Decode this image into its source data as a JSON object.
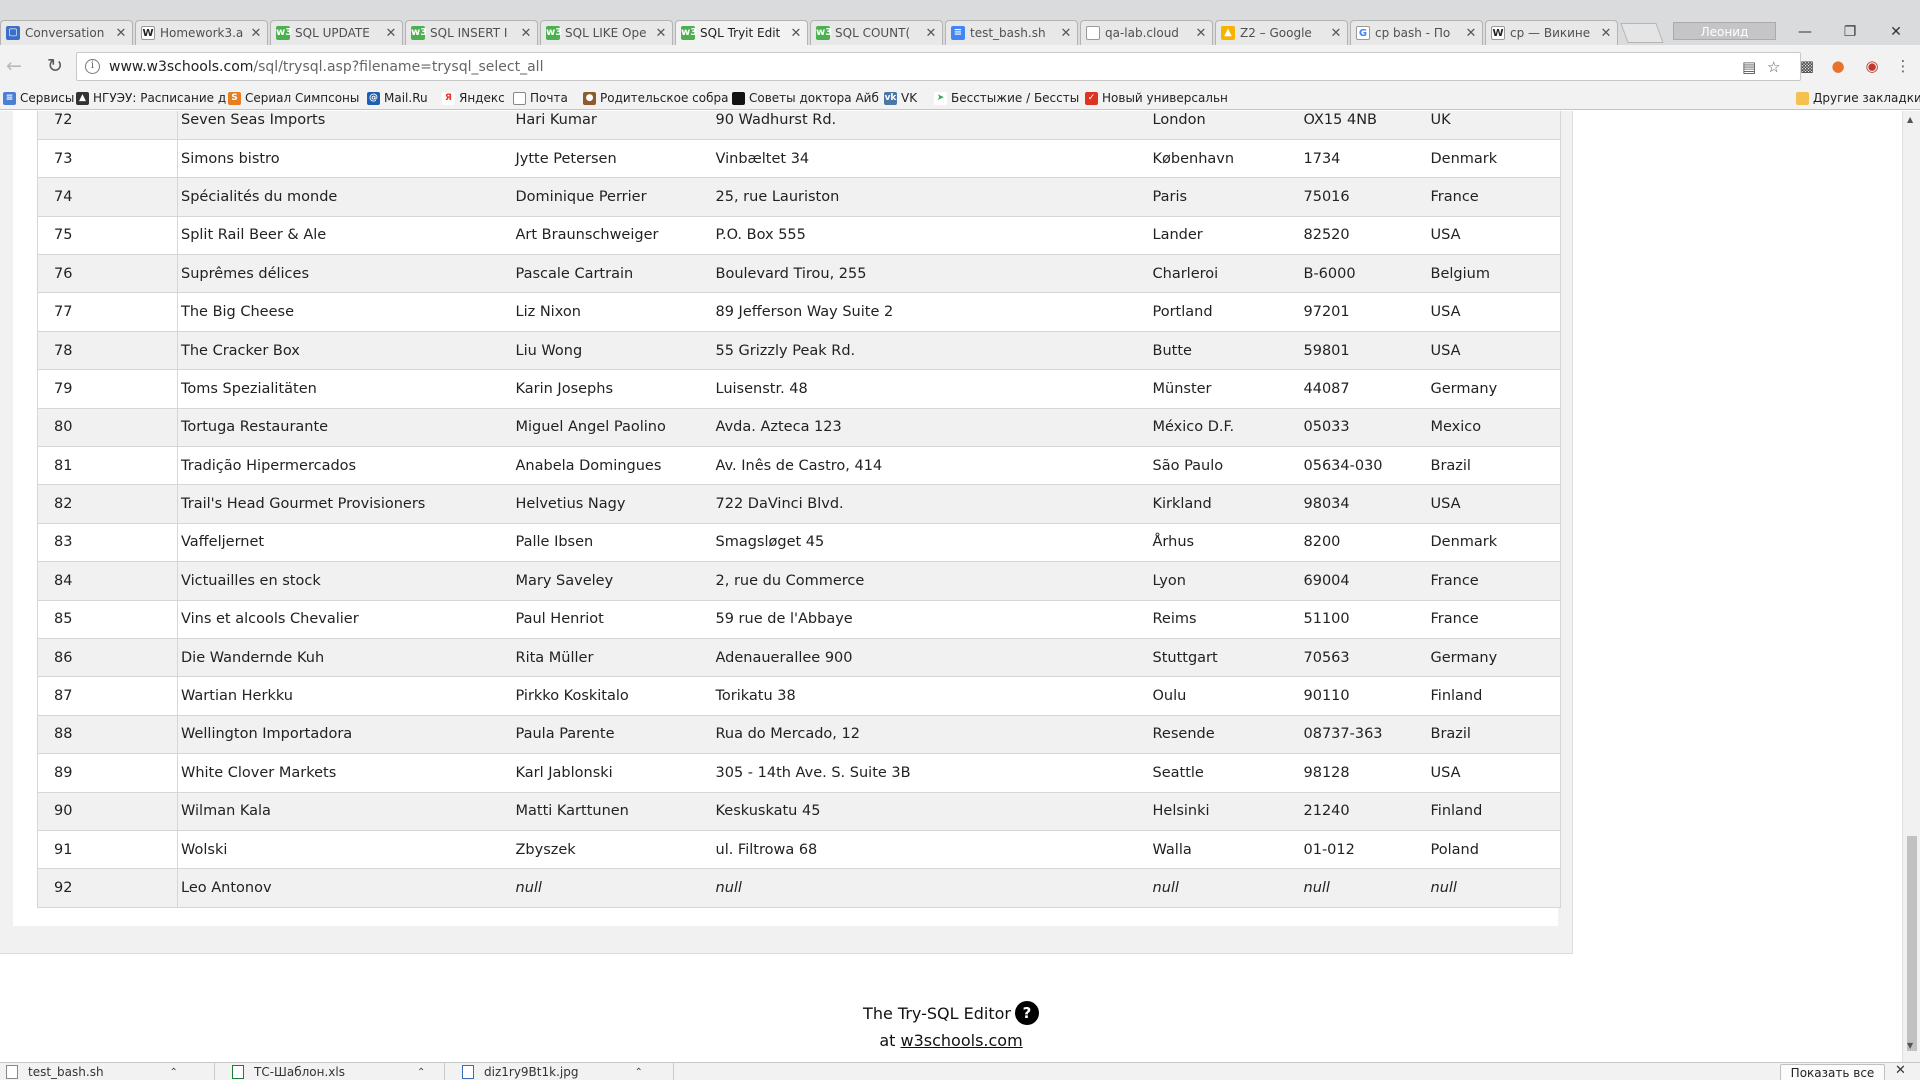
{
  "browser": {
    "tabs": [
      {
        "title": "Conversation",
        "icon": "chat-icon"
      },
      {
        "title": "Homework3.a",
        "icon": "word-icon"
      },
      {
        "title": "SQL UPDATE",
        "icon": "w3-icon"
      },
      {
        "title": "SQL INSERT I",
        "icon": "w3-icon"
      },
      {
        "title": "SQL LIKE Ope",
        "icon": "w3-icon"
      },
      {
        "title": "SQL Tryit Edit",
        "icon": "w3-icon",
        "active": true
      },
      {
        "title": "SQL COUNT(",
        "icon": "w3-icon"
      },
      {
        "title": "test_bash.sh",
        "icon": "doc-icon"
      },
      {
        "title": "qa-lab.cloud",
        "icon": "page-icon"
      },
      {
        "title": "Z2 – Google",
        "icon": "drive-icon"
      },
      {
        "title": "cp bash - По",
        "icon": "google-icon"
      },
      {
        "title": "cp — Викине",
        "icon": "wiki-icon"
      }
    ],
    "user_name": "Леонид Антонов",
    "url_host": "www.w3schools.com",
    "url_path": "/sql/trysql.asp?filename=trysql_select_all",
    "bookmarks": [
      "Сервисы",
      "НГУЭУ: Расписание д",
      "Сериал Симпсоны",
      "Mail.Ru",
      "Яндекс",
      "Почта",
      "Родительское собра",
      "Советы доктора Айб",
      "VK",
      "Бесстыжие / Бессты",
      "Новый универсальн",
      "Другие закладки"
    ]
  },
  "table": {
    "rows": [
      [
        "72",
        "Seven Seas Imports",
        "Hari Kumar",
        "90 Wadhurst Rd.",
        "London",
        "OX15 4NB",
        "UK"
      ],
      [
        "73",
        "Simons bistro",
        "Jytte Petersen",
        "Vinbæltet 34",
        "København",
        "1734",
        "Denmark"
      ],
      [
        "74",
        "Spécialités du monde",
        "Dominique Perrier",
        "25, rue Lauriston",
        "Paris",
        "75016",
        "France"
      ],
      [
        "75",
        "Split Rail Beer & Ale",
        "Art Braunschweiger",
        "P.O. Box 555",
        "Lander",
        "82520",
        "USA"
      ],
      [
        "76",
        "Suprêmes délices",
        "Pascale Cartrain",
        "Boulevard Tirou, 255",
        "Charleroi",
        "B-6000",
        "Belgium"
      ],
      [
        "77",
        "The Big Cheese",
        "Liz Nixon",
        "89 Jefferson Way Suite 2",
        "Portland",
        "97201",
        "USA"
      ],
      [
        "78",
        "The Cracker Box",
        "Liu Wong",
        "55 Grizzly Peak Rd.",
        "Butte",
        "59801",
        "USA"
      ],
      [
        "79",
        "Toms Spezialitäten",
        "Karin Josephs",
        "Luisenstr. 48",
        "Münster",
        "44087",
        "Germany"
      ],
      [
        "80",
        "Tortuga Restaurante",
        "Miguel Angel Paolino",
        "Avda. Azteca 123",
        "México D.F.",
        "05033",
        "Mexico"
      ],
      [
        "81",
        "Tradição Hipermercados",
        "Anabela Domingues",
        "Av. Inês de Castro, 414",
        "São Paulo",
        "05634-030",
        "Brazil"
      ],
      [
        "82",
        "Trail's Head Gourmet Provisioners",
        "Helvetius Nagy",
        "722 DaVinci Blvd.",
        "Kirkland",
        "98034",
        "USA"
      ],
      [
        "83",
        "Vaffeljernet",
        "Palle Ibsen",
        "Smagsløget 45",
        "Århus",
        "8200",
        "Denmark"
      ],
      [
        "84",
        "Victuailles en stock",
        "Mary Saveley",
        "2, rue du Commerce",
        "Lyon",
        "69004",
        "France"
      ],
      [
        "85",
        "Vins et alcools Chevalier",
        "Paul Henriot",
        "59 rue de l'Abbaye",
        "Reims",
        "51100",
        "France"
      ],
      [
        "86",
        "Die Wandernde Kuh",
        "Rita Müller",
        "Adenauerallee 900",
        "Stuttgart",
        "70563",
        "Germany"
      ],
      [
        "87",
        "Wartian Herkku",
        "Pirkko Koskitalo",
        "Torikatu 38",
        "Oulu",
        "90110",
        "Finland"
      ],
      [
        "88",
        "Wellington Importadora",
        "Paula Parente",
        "Rua do Mercado, 12",
        "Resende",
        "08737-363",
        "Brazil"
      ],
      [
        "89",
        "White Clover Markets",
        "Karl Jablonski",
        "305 - 14th Ave. S. Suite 3B",
        "Seattle",
        "98128",
        "USA"
      ],
      [
        "90",
        "Wilman Kala",
        "Matti Karttunen",
        "Keskuskatu 45",
        "Helsinki",
        "21240",
        "Finland"
      ],
      [
        "91",
        "Wolski",
        "Zbyszek",
        "ul. Filtrowa 68",
        "Walla",
        "01-012",
        "Poland"
      ],
      [
        "92",
        "Leo Antonov",
        "null",
        "null",
        "null",
        "null",
        "null"
      ]
    ]
  },
  "footer": {
    "title": "The Try-SQL Editor",
    "help_symbol": "?",
    "at": "at",
    "link": "w3schools.com"
  },
  "downloads": {
    "items": [
      "test_bash.sh",
      "ТС-Шаблон.xls",
      "diz1ry9Bt1k.jpg"
    ],
    "show_all": "Показать все"
  }
}
